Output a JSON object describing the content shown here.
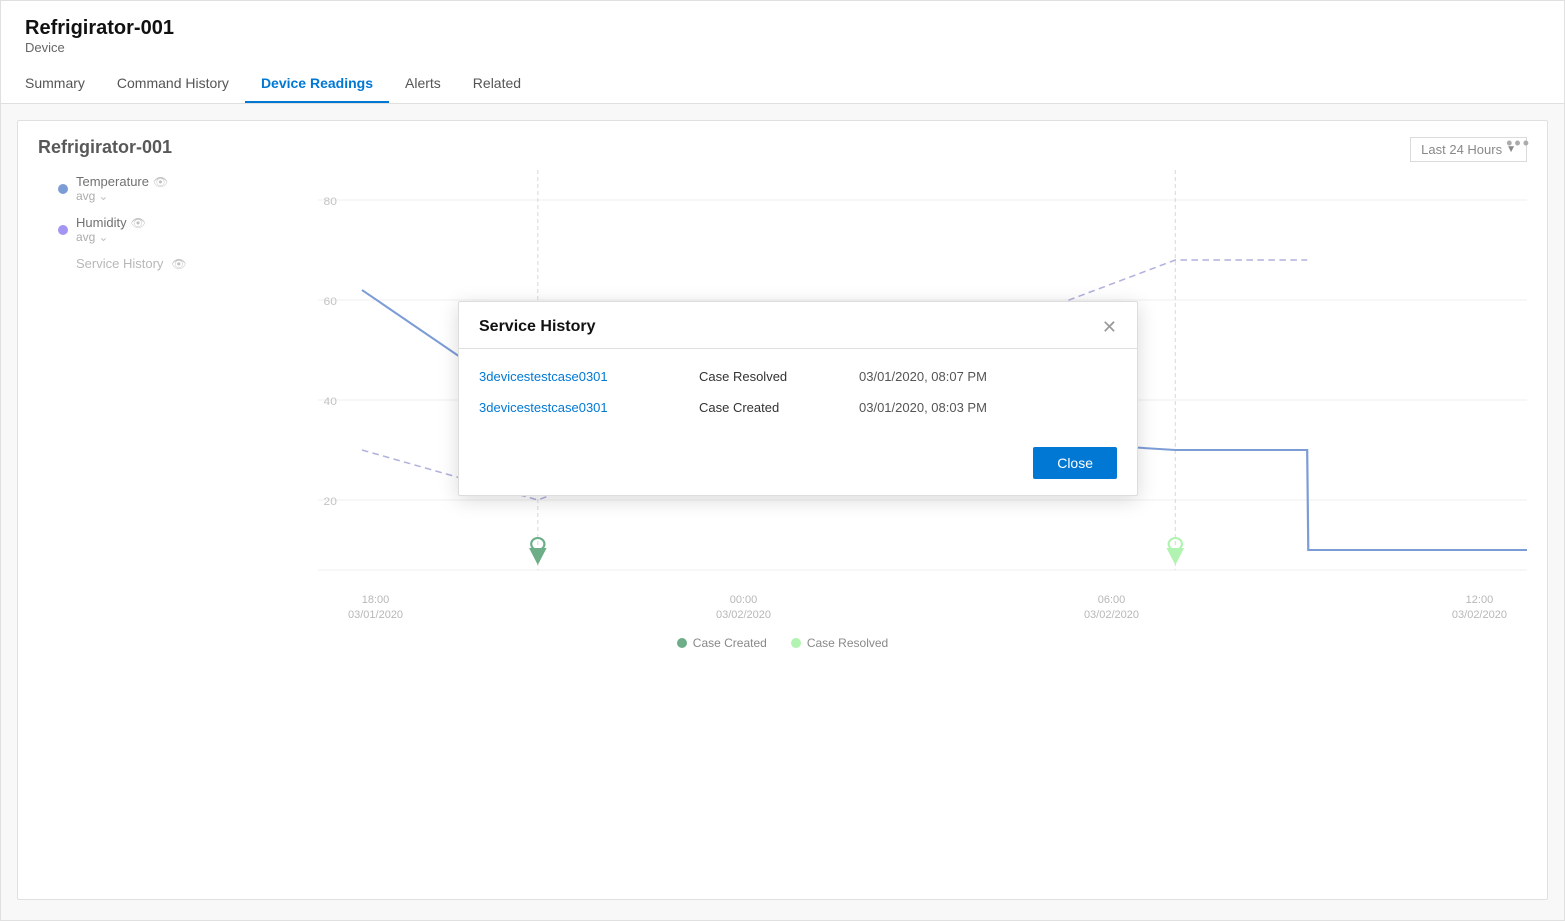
{
  "page": {
    "device_name": "Refrigirator-001",
    "device_type": "Device"
  },
  "tabs": [
    {
      "id": "summary",
      "label": "Summary",
      "active": false
    },
    {
      "id": "command-history",
      "label": "Command History",
      "active": false
    },
    {
      "id": "device-readings",
      "label": "Device Readings",
      "active": true
    },
    {
      "id": "alerts",
      "label": "Alerts",
      "active": false
    },
    {
      "id": "related",
      "label": "Related",
      "active": false
    }
  ],
  "chart": {
    "title": "Refrigirator-001",
    "time_filter": "Last 24 Hours",
    "more_options_label": "•••",
    "legend": [
      {
        "id": "temperature",
        "label": "Temperature",
        "sub": "avg",
        "color": "#4472c4",
        "type": "blue"
      },
      {
        "id": "humidity",
        "label": "Humidity",
        "sub": "avg",
        "color": "#7b68ee",
        "type": "purple"
      },
      {
        "id": "service-history",
        "label": "Service History",
        "type": "service"
      }
    ],
    "y_axis": [
      "80",
      "60",
      "40",
      "20"
    ],
    "x_axis": [
      {
        "time": "18:00",
        "date": "03/01/2020"
      },
      {
        "time": "00:00",
        "date": "03/02/2020"
      },
      {
        "time": "06:00",
        "date": "03/02/2020"
      },
      {
        "time": "12:00",
        "date": "03/02/2020"
      }
    ],
    "bottom_legend": [
      {
        "id": "case-created",
        "label": "Case Created",
        "color_class": "green-dark"
      },
      {
        "id": "case-resolved",
        "label": "Case Resolved",
        "color_class": "green-light"
      }
    ]
  },
  "modal": {
    "title": "Service History",
    "rows": [
      {
        "link": "3devicestestcase0301",
        "status": "Case Resolved",
        "datetime": "03/01/2020, 08:07 PM"
      },
      {
        "link": "3devicestestcase0301",
        "status": "Case Created",
        "datetime": "03/01/2020, 08:03 PM"
      }
    ],
    "close_label": "Close"
  }
}
